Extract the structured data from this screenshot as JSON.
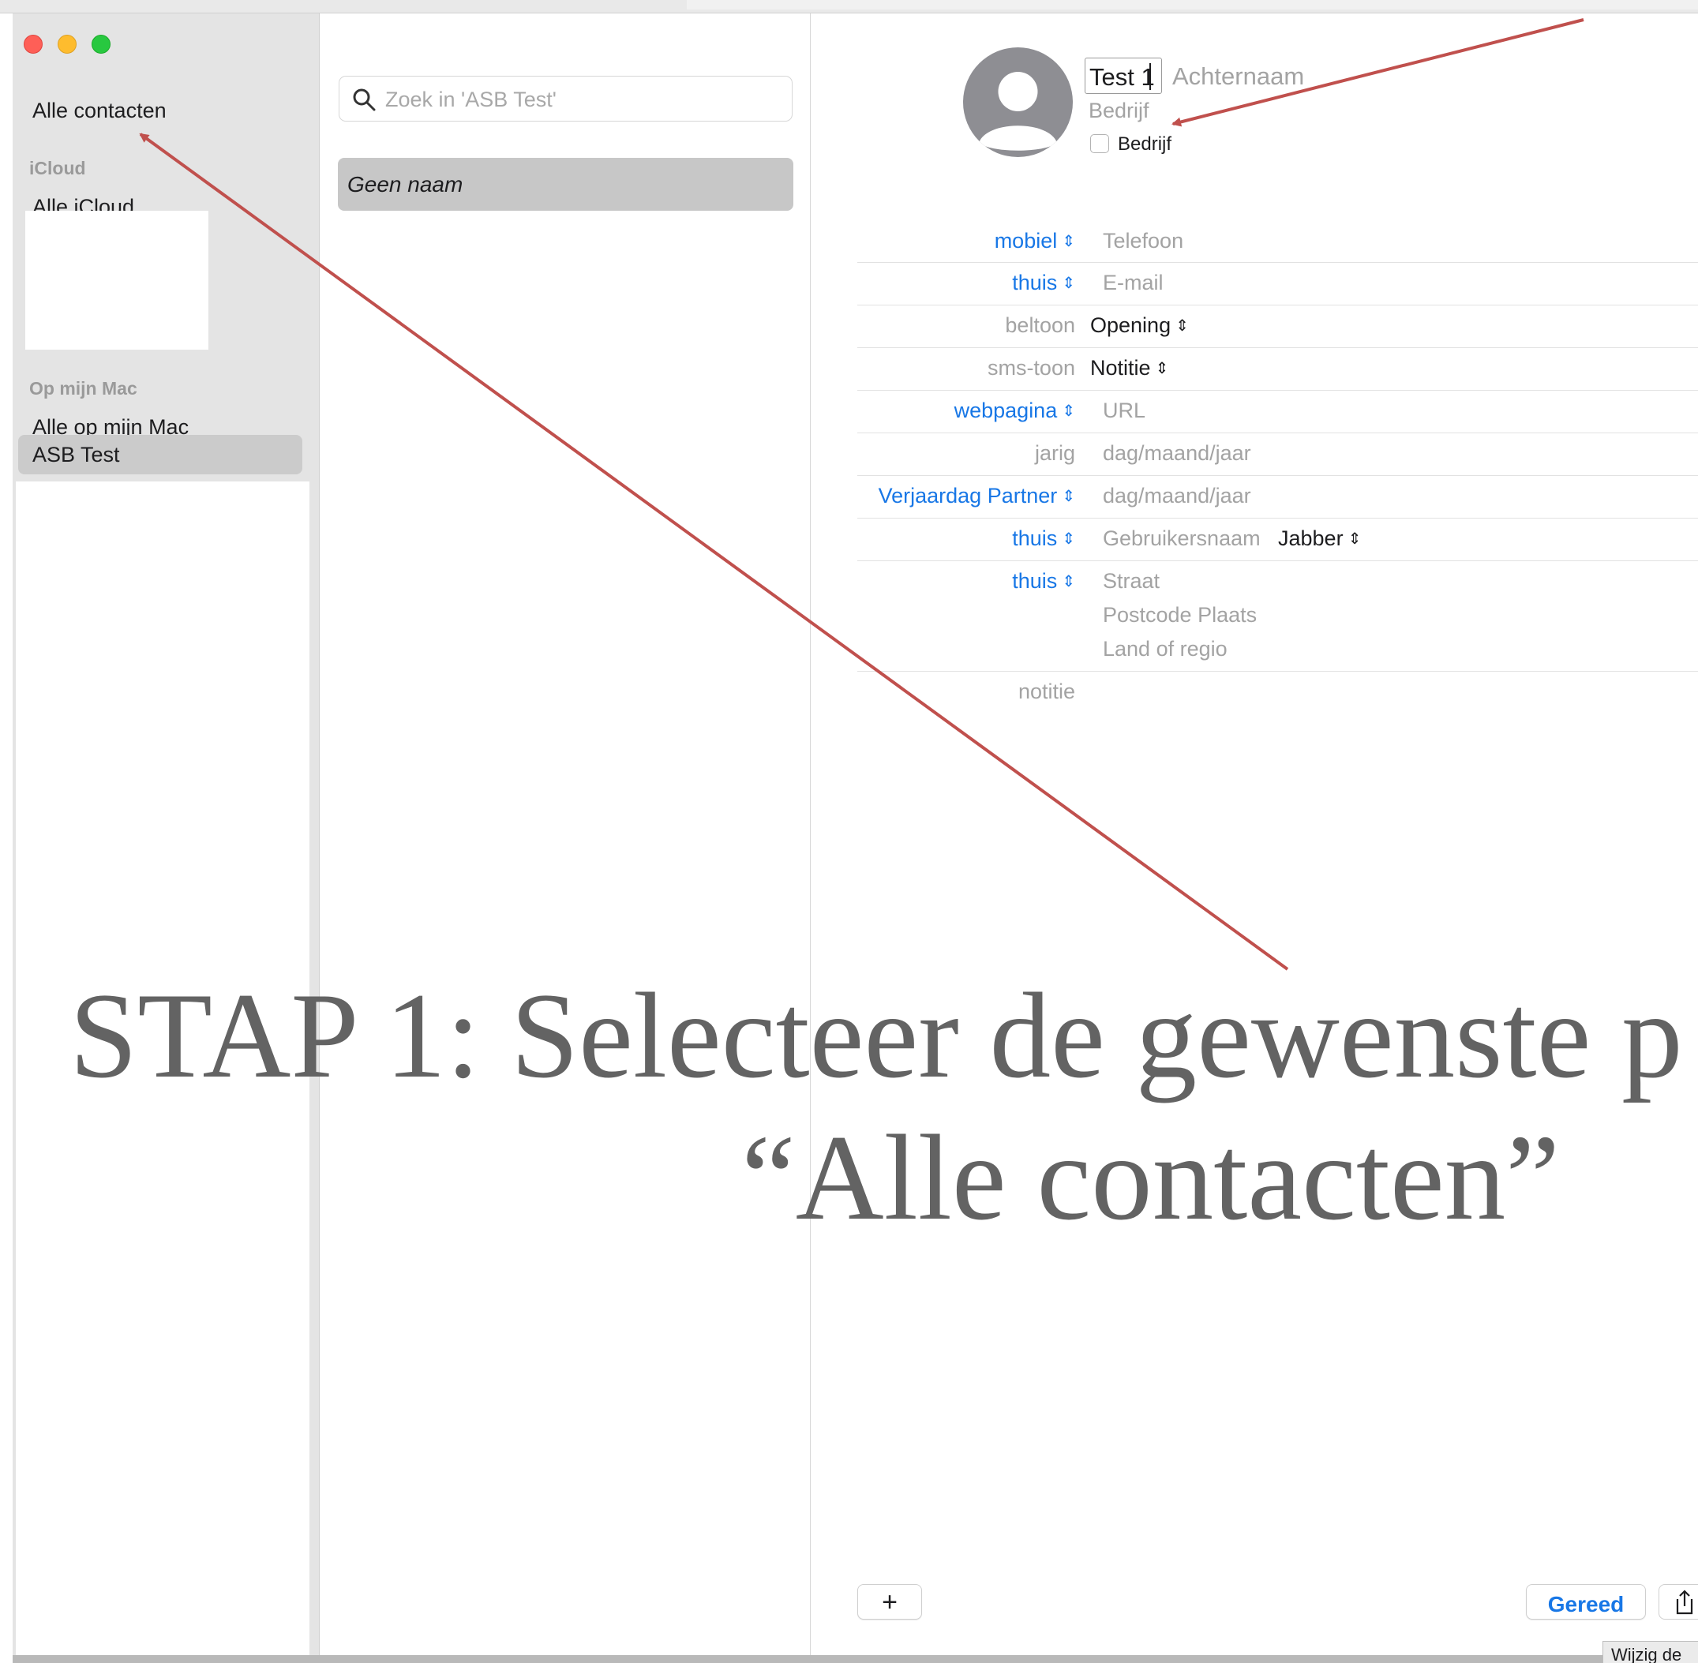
{
  "sidebar": {
    "all_contacts": "Alle contacten",
    "sections": [
      {
        "header": "iCloud",
        "items": [
          "Alle iCloud"
        ]
      },
      {
        "header": "Op mijn Mac",
        "items": [
          "Alle op mijn Mac",
          "ASB Test"
        ]
      }
    ],
    "selected_item": "ASB Test"
  },
  "list": {
    "search_placeholder": "Zoek in 'ASB Test'",
    "rows": [
      "Geen naam"
    ]
  },
  "card": {
    "first_name": "Test 1",
    "last_name_placeholder": "Achternaam",
    "company_placeholder": "Bedrijf",
    "company_checkbox_label": "Bedrijf",
    "company_checked": false,
    "fields": [
      {
        "label": "mobiel",
        "label_selectable": true,
        "value": "Telefoon",
        "value_is_placeholder": true
      },
      {
        "label": "thuis",
        "label_selectable": true,
        "value": "E-mail",
        "value_is_placeholder": true
      },
      {
        "label": "beltoon",
        "label_selectable": false,
        "value": "Opening",
        "value_is_placeholder": false
      },
      {
        "label": "sms-toon",
        "label_selectable": false,
        "value": "Notitie",
        "value_is_placeholder": false
      },
      {
        "label": "webpagina",
        "label_selectable": true,
        "value": "URL",
        "value_is_placeholder": true
      },
      {
        "label": "jarig",
        "label_selectable": false,
        "value": "dag/maand/jaar",
        "value_is_placeholder": true
      },
      {
        "label": "Verjaardag Partner",
        "label_selectable": true,
        "value": "dag/maand/jaar",
        "value_is_placeholder": true
      },
      {
        "label": "thuis",
        "label_selectable": true,
        "value": "Gebruikersnaam",
        "value_is_placeholder": true,
        "service": "Jabber"
      },
      {
        "label": "thuis",
        "label_selectable": true,
        "address_lines": [
          "Straat",
          "Postcode Plaats",
          "Land of regio"
        ]
      },
      {
        "label": "notitie",
        "label_selectable": false,
        "value": ""
      }
    ]
  },
  "toolbar": {
    "add_label": "+",
    "done_label": "Gereed",
    "tooltip": "Wijzig de"
  },
  "overlay": {
    "line1": "STAP 1: Selecteer de gewenste p",
    "line2": "“Alle contacten”"
  },
  "colors": {
    "accent": "#1877e6",
    "sidebar_bg": "#e4e4e4",
    "selection": "#c7c7c7",
    "annotation_arrow": "#c0504d",
    "caption": "#636363"
  },
  "icons": [
    "search-icon",
    "person-icon",
    "updown-chevron-icon",
    "share-icon"
  ]
}
